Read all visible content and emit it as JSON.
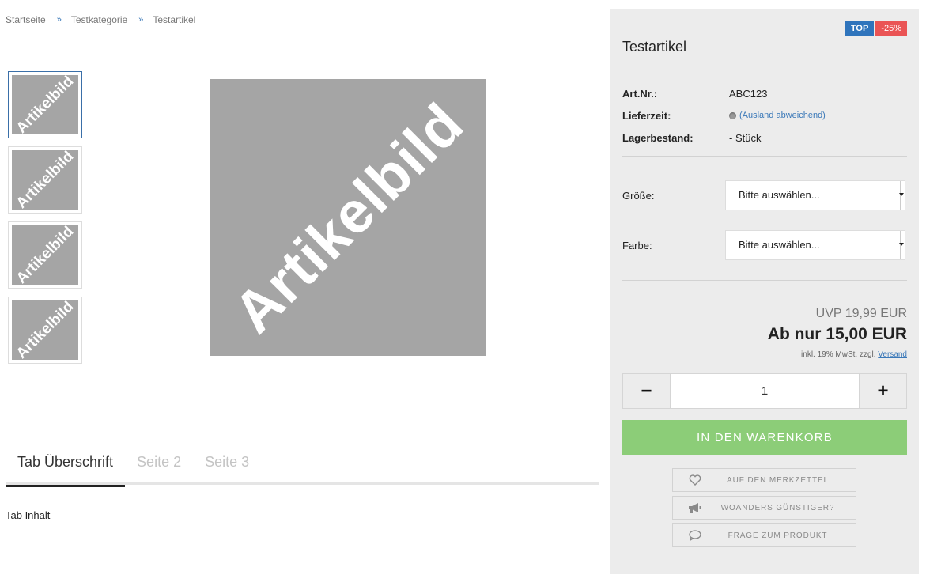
{
  "breadcrumb": {
    "items": [
      "Startseite",
      "Testkategorie",
      "Testartikel"
    ],
    "separator": "»"
  },
  "gallery": {
    "placeholder_text": "Artikelbild",
    "thumb_count": 4
  },
  "tabs": {
    "items": [
      "Tab Überschrift",
      "Seite 2",
      "Seite 3"
    ],
    "active": 0,
    "content": "Tab Inhalt"
  },
  "product": {
    "badges": {
      "top": "TOP",
      "discount": "-25%"
    },
    "title": "Testartikel",
    "info": {
      "art_nr_label": "Art.Nr.:",
      "art_nr_value": "ABC123",
      "delivery_label": "Lieferzeit:",
      "delivery_value": "(Ausland abweichend)",
      "stock_label": "Lagerbestand:",
      "stock_value": "- Stück"
    },
    "options": {
      "size_label": "Größe:",
      "size_value": "Bitte auswählen...",
      "color_label": "Farbe:",
      "color_value": "Bitte auswählen..."
    },
    "price": {
      "uvp": "UVP 19,99 EUR",
      "current": "Ab nur 15,00 EUR",
      "tax_text": "inkl. 19% MwSt. zzgl.",
      "shipping_link": "Versand"
    },
    "quantity": {
      "minus": "−",
      "value": "1",
      "plus": "+"
    },
    "cart_button": "IN DEN WARENKORB",
    "actions": {
      "wishlist": "AUF DEN MERKZETTEL",
      "cheaper": "WOANDERS GÜNSTIGER?",
      "question": "FRAGE ZUM PRODUKT"
    }
  },
  "colors": {
    "accent": "#3a78b8",
    "badge_top": "#2f74bc",
    "badge_discount": "#ea5455",
    "cart_button": "#8ccd78",
    "sidebar_bg": "#ececec",
    "placeholder_bg": "#a5a5a5"
  }
}
